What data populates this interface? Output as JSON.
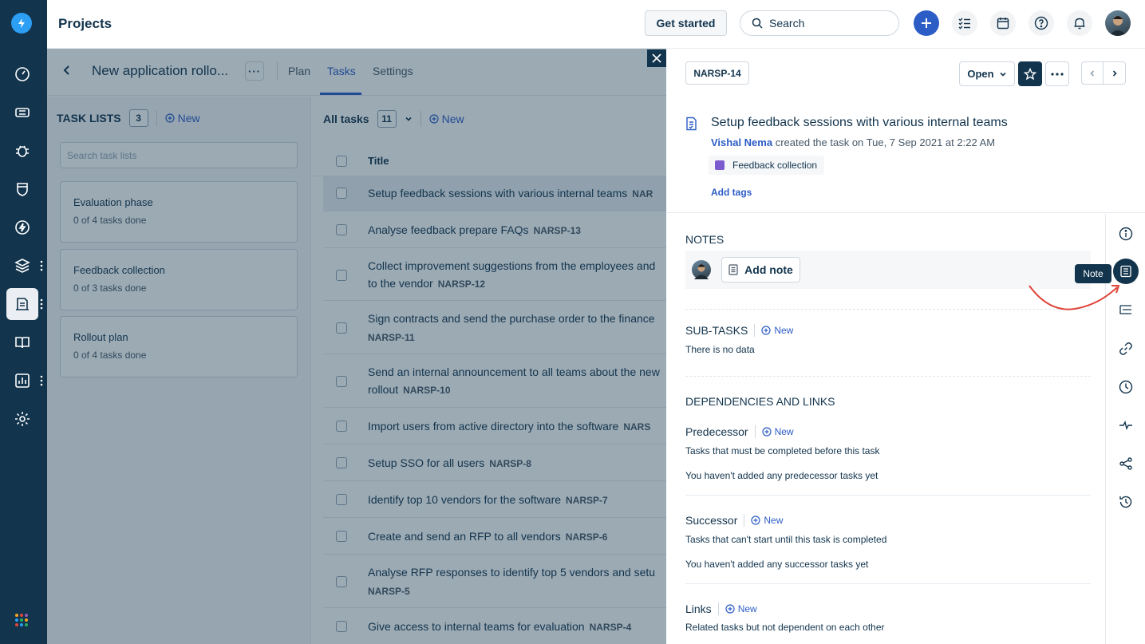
{
  "app": {
    "title": "Projects"
  },
  "topbar": {
    "get_started": "Get started",
    "search_placeholder": "Search"
  },
  "project": {
    "name": "New application rollo...",
    "tabs": [
      {
        "label": "Plan"
      },
      {
        "label": "Tasks"
      },
      {
        "label": "Settings"
      }
    ],
    "active_tab": "Tasks"
  },
  "task_lists": {
    "header": "TASK LISTS",
    "count": "3",
    "new_label": "New",
    "search_placeholder": "Search task lists",
    "items": [
      {
        "name": "Evaluation phase",
        "progress": "0 of 4 tasks done"
      },
      {
        "name": "Feedback collection",
        "progress": "0 of 3 tasks done"
      },
      {
        "name": "Rollout plan",
        "progress": "0 of 4 tasks done"
      }
    ]
  },
  "tasks": {
    "header": "All tasks",
    "count": "11",
    "new_label": "New",
    "col_title": "Title",
    "rows": [
      {
        "line1": "Setup feedback sessions with various internal teams",
        "id": "NAR",
        "line2": ""
      },
      {
        "line1": "Analyse feedback prepare FAQs",
        "id": "NARSP-13",
        "line2": ""
      },
      {
        "line1": "Collect improvement suggestions from the employees and",
        "id": "NARSP-12",
        "line2": "to the vendor"
      },
      {
        "line1": "Sign contracts and send the purchase order to the finance",
        "id": "NARSP-11",
        "line2": ""
      },
      {
        "line1": "Send an internal announcement to all teams about the new",
        "id": "NARSP-10",
        "line2": "rollout"
      },
      {
        "line1": "Import users from active directory into the software",
        "id": "NARS",
        "line2": ""
      },
      {
        "line1": "Setup SSO for all users",
        "id": "NARSP-8",
        "line2": ""
      },
      {
        "line1": "Identify top 10 vendors for the software",
        "id": "NARSP-7",
        "line2": ""
      },
      {
        "line1": "Create and send an RFP to all vendors",
        "id": "NARSP-6",
        "line2": ""
      },
      {
        "line1": "Analyse RFP responses to identify top 5 vendors and setu",
        "id": "NARSP-5",
        "line2": ""
      },
      {
        "line1": "Give access to internal teams for evaluation",
        "id": "NARSP-4",
        "line2": ""
      }
    ]
  },
  "detail": {
    "id": "NARSP-14",
    "status": "Open",
    "title": "Setup feedback sessions with various internal teams",
    "creator": "Vishal Nema",
    "created_text": "created the task on Tue, 7 Sep 2021 at 2:22 AM",
    "task_list_chip": "Feedback collection",
    "add_tags": "Add tags",
    "notes_title": "NOTES",
    "add_note": "Add note",
    "subtasks_title": "SUB-TASKS",
    "subtasks_empty": "There is no data",
    "deps_title": "DEPENDENCIES AND LINKS",
    "new_label": "New",
    "predecessor": {
      "title": "Predecessor",
      "desc": "Tasks that must be completed before this task",
      "empty": "You haven't added any predecessor tasks yet"
    },
    "successor": {
      "title": "Successor",
      "desc": "Tasks that can't start until this task is completed",
      "empty": "You haven't added any successor tasks yet"
    },
    "links": {
      "title": "Links",
      "desc": "Related tasks but not dependent on each other"
    },
    "tooltip": "Note"
  },
  "colors": {
    "rail": "#12344d",
    "accent": "#2c5cc5",
    "annotation_arrow": "#e0453a"
  }
}
